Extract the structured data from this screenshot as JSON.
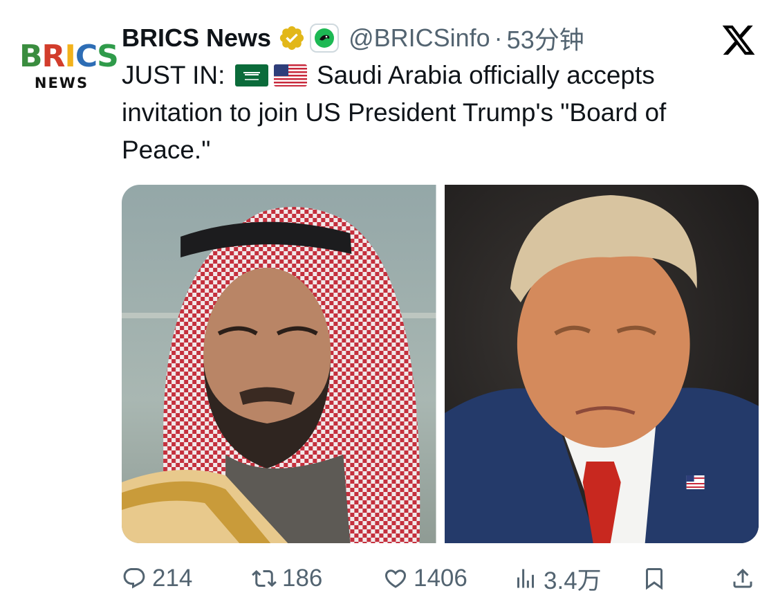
{
  "account": {
    "avatar_logo_word": "BRICS",
    "avatar_logo_sub": "NEWS",
    "display_name": "BRICS News",
    "handle": "@BRICSinfo",
    "separator": "·",
    "time_ago": "53分钟",
    "verified_icon": "verified-badge-gold",
    "affiliate_icon": "affiliate-badge"
  },
  "platform_icon": "x-logo",
  "tweet": {
    "prefix": "JUST IN:",
    "flags": [
      "saudi-arabia-flag",
      "us-flag"
    ],
    "body": "Saudi Arabia officially accepts invitation to join US President Trump's \"Board of Peace.\""
  },
  "media": [
    {
      "name": "photo-left",
      "description_icon": "portrait-photo"
    },
    {
      "name": "photo-right",
      "description_icon": "portrait-photo"
    }
  ],
  "actions": {
    "replies": "214",
    "reposts": "186",
    "likes": "1406",
    "views": "3.4万"
  },
  "colors": {
    "text": "#0f1419",
    "secondary": "#536471",
    "verified": "#e2b719"
  }
}
